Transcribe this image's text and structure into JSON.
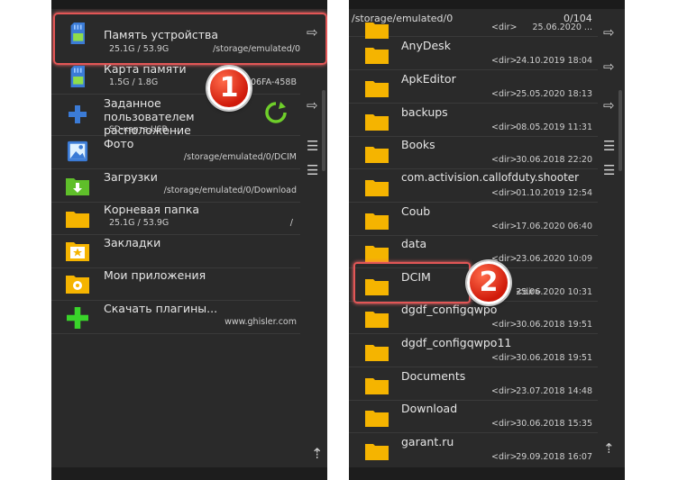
{
  "left": {
    "items": [
      {
        "name": "Память устройства",
        "sub_left": "25.1G / 53.9G",
        "sub_right": "/storage/emulated/0",
        "icon": "sd-card-icon"
      },
      {
        "name": "Карта памяти",
        "sub_left": "1.5G / 1.8G",
        "sub_right": "06FA-458B",
        "icon": "sd-card-icon"
      },
      {
        "name": "Заданное пользователем расположение",
        "sub_left": "SD-карта,USB,...",
        "sub_right": "",
        "icon": "plus-icon"
      },
      {
        "name": "Фото",
        "sub_left": "",
        "sub_right": "/storage/emulated/0/DCIM",
        "icon": "photo-icon"
      },
      {
        "name": "Загрузки",
        "sub_left": "",
        "sub_right": "/storage/emulated/0/Download",
        "icon": "download-folder-icon"
      },
      {
        "name": "Корневая папка",
        "sub_left": "25.1G / 53.9G",
        "sub_right": "/",
        "icon": "folder-icon"
      },
      {
        "name": "Закладки",
        "sub_left": "",
        "sub_right": "",
        "icon": "bookmark-folder-icon"
      },
      {
        "name": "Мои приложения",
        "sub_left": "",
        "sub_right": "",
        "icon": "apps-folder-icon"
      },
      {
        "name": "Скачать плагины...",
        "sub_left": "",
        "sub_right": "www.ghisler.com",
        "icon": "green-plus-icon"
      }
    ],
    "badge": "1"
  },
  "right": {
    "path": "/storage/emulated/0",
    "count": "0/104",
    "badge": "2",
    "folders": [
      {
        "name": "",
        "dir": "<dir>",
        "date": "25.06.2020 ..."
      },
      {
        "name": "AnyDesk",
        "dir": "<dir>",
        "date": "24.10.2019 18:04"
      },
      {
        "name": "ApkEditor",
        "dir": "<dir>",
        "date": "25.05.2020 18:13"
      },
      {
        "name": "backups",
        "dir": "<dir>",
        "date": "08.05.2019 11:31"
      },
      {
        "name": "Books",
        "dir": "<dir>",
        "date": "30.06.2018 22:20"
      },
      {
        "name": "com.activision.callofduty.shooter",
        "dir": "<dir>",
        "date": "01.10.2019 12:54"
      },
      {
        "name": "Coub",
        "dir": "<dir>",
        "date": "17.06.2020 06:40"
      },
      {
        "name": "data",
        "dir": "<dir>",
        "date": "23.06.2020 10:09"
      },
      {
        "name": "DCIM",
        "dir": "<dir>",
        "date": "25.06.2020 10:31"
      },
      {
        "name": "dgdf_configqwpo",
        "dir": "<dir>",
        "date": "30.06.2018 19:51"
      },
      {
        "name": "dgdf_configqwpo11",
        "dir": "<dir>",
        "date": "30.06.2018 19:51"
      },
      {
        "name": "Documents",
        "dir": "<dir>",
        "date": "23.07.2018 14:48"
      },
      {
        "name": "Download",
        "dir": "<dir>",
        "date": "30.06.2018 15:35"
      },
      {
        "name": "garant.ru",
        "dir": "<dir>",
        "date": "29.09.2018 16:07"
      }
    ]
  },
  "colors": {
    "accent_red": "#e25656",
    "folder": "#f5b400",
    "background": "#2a2a2a"
  }
}
